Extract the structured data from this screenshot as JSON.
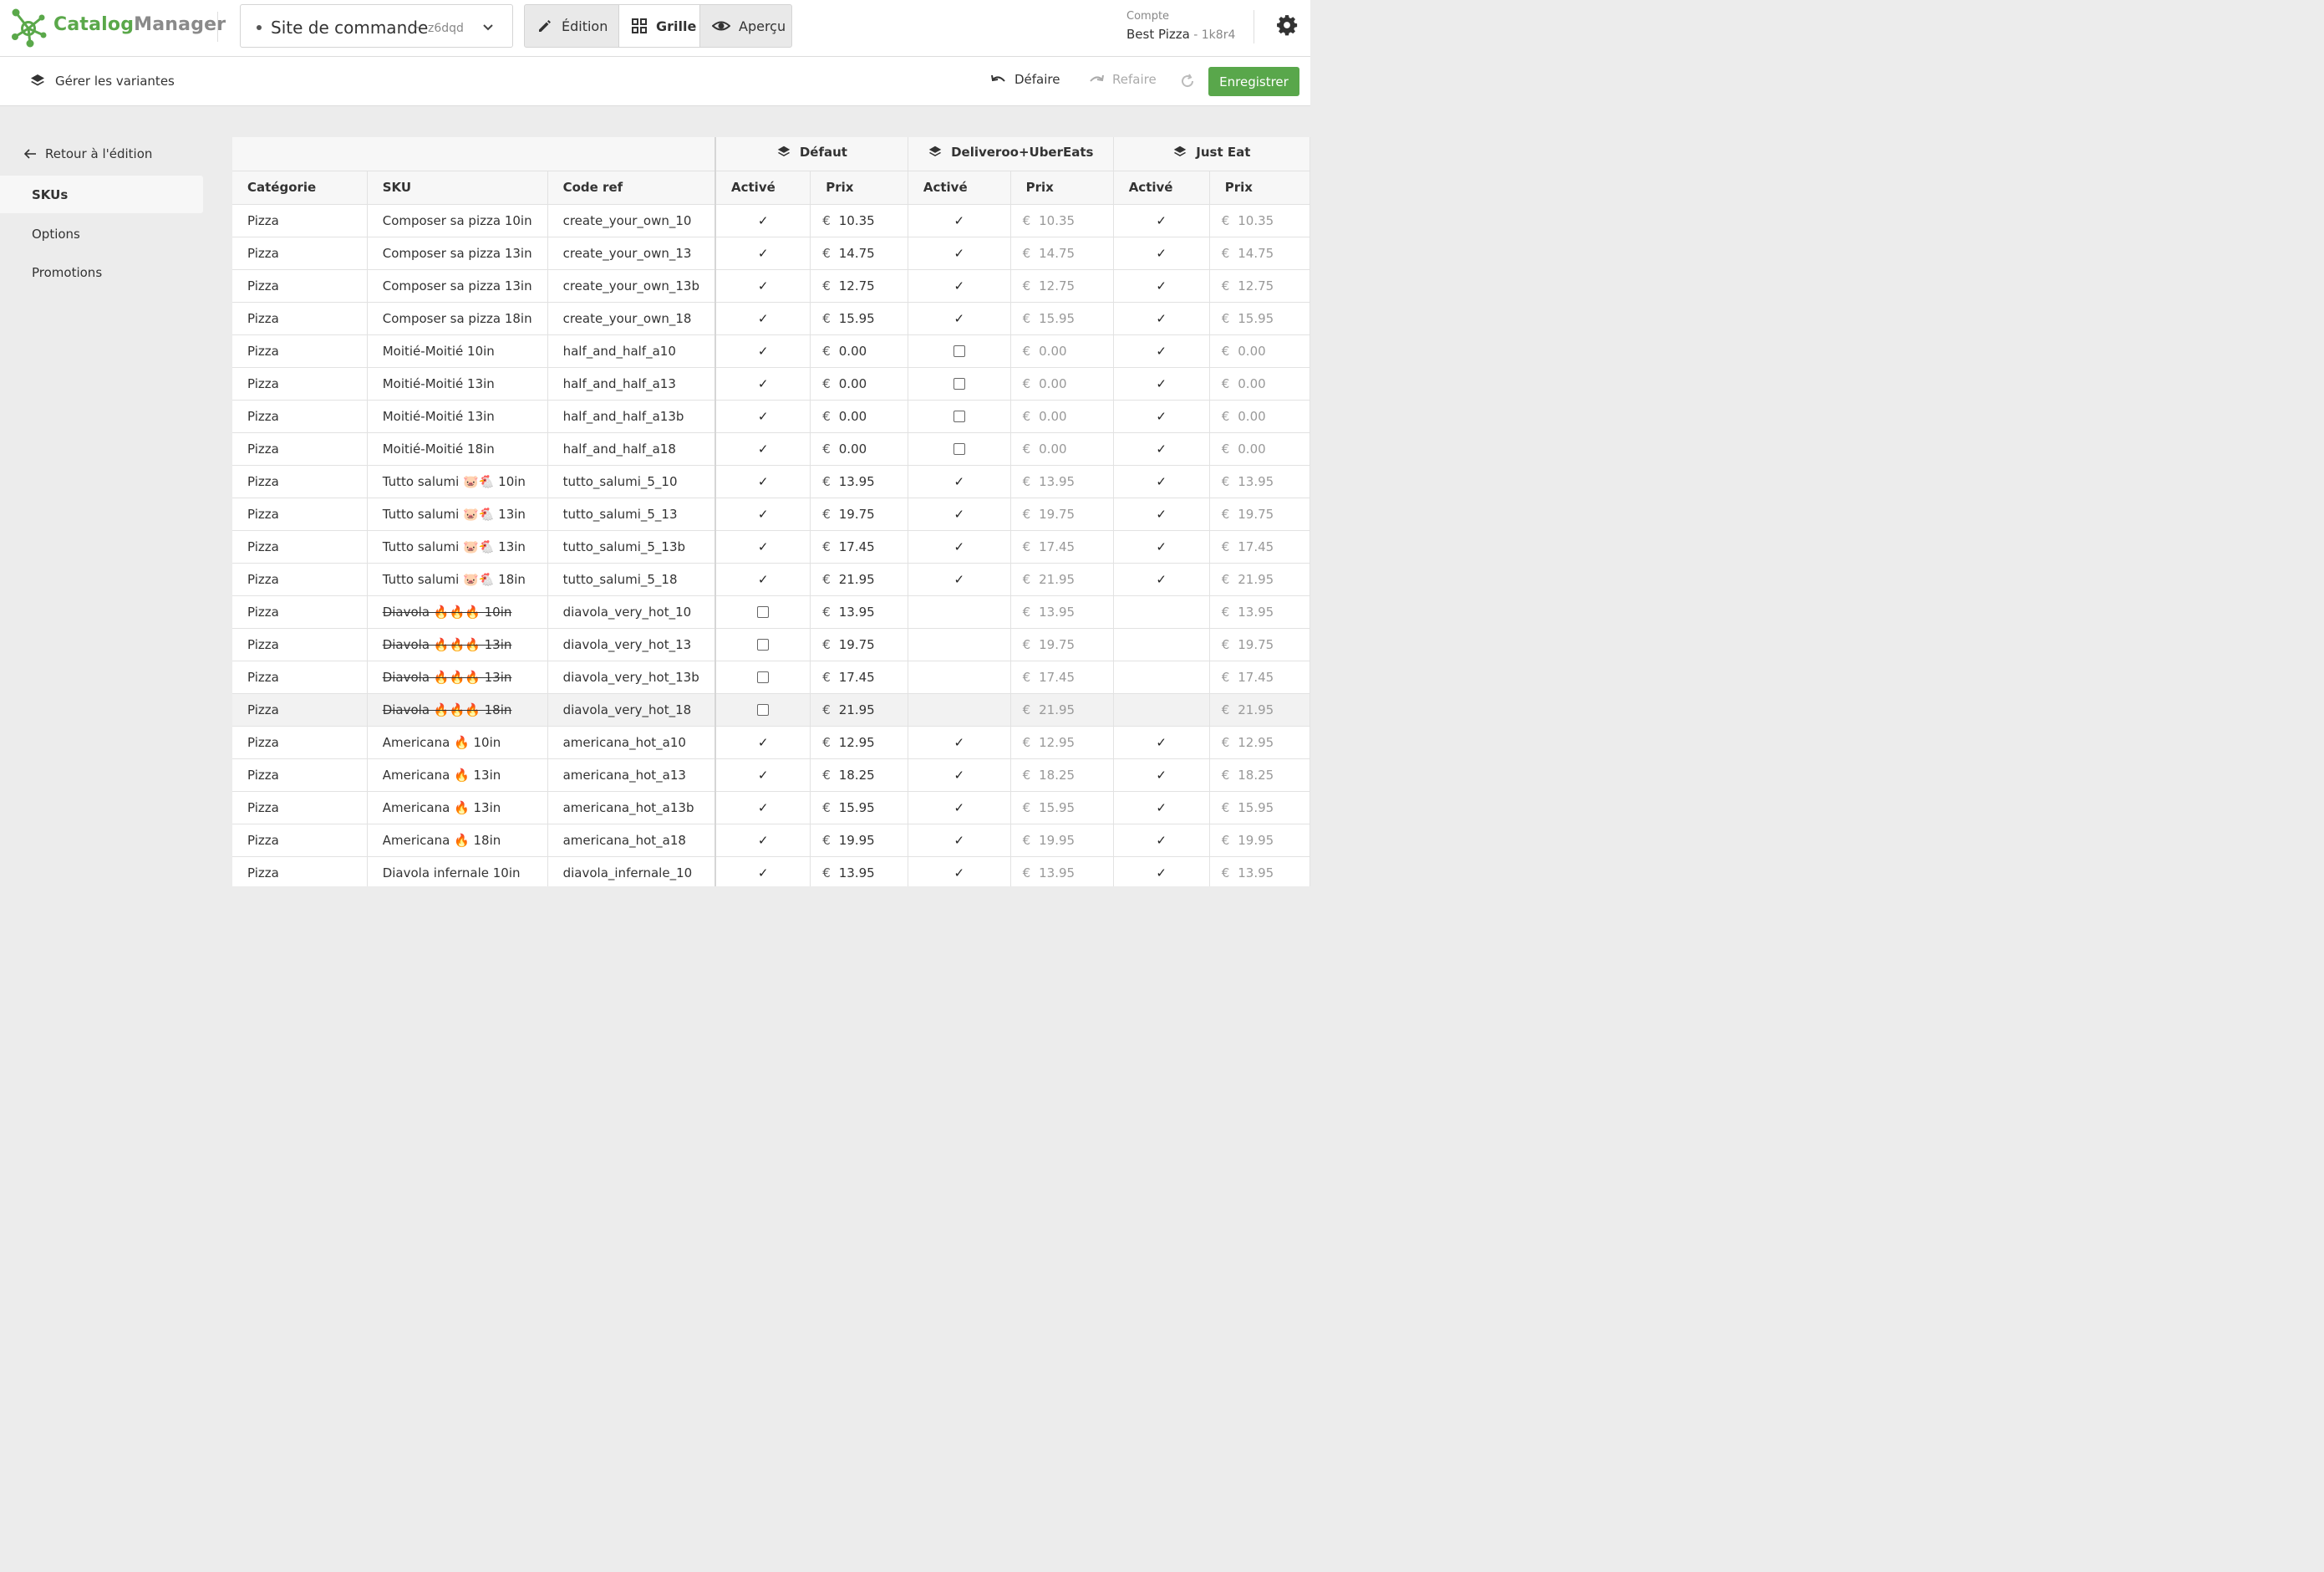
{
  "app": {
    "brand_a": "Catalog",
    "brand_b": "Manager"
  },
  "site": {
    "name": "Site de commande",
    "separator": "-",
    "code": "z6dqd"
  },
  "modes": {
    "edit": "Édition",
    "grid": "Grille",
    "preview": "Aperçu"
  },
  "account": {
    "label": "Compte",
    "name": "Best Pizza",
    "separator": " - ",
    "code": "1k8r4"
  },
  "toolbar": {
    "variants": "Gérer les variantes",
    "undo": "Défaire",
    "redo": "Refaire",
    "save": "Enregistrer"
  },
  "sidebar": {
    "back": "Retour à l'édition",
    "items": [
      {
        "label": "SKUs",
        "active": true
      },
      {
        "label": "Options",
        "active": false
      },
      {
        "label": "Promotions",
        "active": false
      }
    ]
  },
  "table": {
    "variants": [
      "Défaut",
      "Deliveroo+UberEats",
      "Just Eat"
    ],
    "columns": {
      "category": "Catégorie",
      "sku": "SKU",
      "code": "Code ref",
      "active": "Activé",
      "price": "Prix"
    },
    "currency": "€",
    "rows": [
      {
        "category": "Pizza",
        "sku": "Composer sa pizza 10in",
        "code": "create_your_own_10",
        "strike": false,
        "v": [
          [
            "check",
            "10.35"
          ],
          [
            "check",
            "10.35"
          ],
          [
            "check",
            "10.35"
          ]
        ]
      },
      {
        "category": "Pizza",
        "sku": "Composer sa pizza 13in",
        "code": "create_your_own_13",
        "strike": false,
        "v": [
          [
            "check",
            "14.75"
          ],
          [
            "check",
            "14.75"
          ],
          [
            "check",
            "14.75"
          ]
        ]
      },
      {
        "category": "Pizza",
        "sku": "Composer sa pizza 13in",
        "code": "create_your_own_13b",
        "strike": false,
        "v": [
          [
            "check",
            "12.75"
          ],
          [
            "check",
            "12.75"
          ],
          [
            "check",
            "12.75"
          ]
        ]
      },
      {
        "category": "Pizza",
        "sku": "Composer sa pizza 18in",
        "code": "create_your_own_18",
        "strike": false,
        "v": [
          [
            "check",
            "15.95"
          ],
          [
            "check",
            "15.95"
          ],
          [
            "check",
            "15.95"
          ]
        ]
      },
      {
        "category": "Pizza",
        "sku": "Moitié-Moitié 10in",
        "code": "half_and_half_a10",
        "strike": false,
        "v": [
          [
            "check",
            "0.00"
          ],
          [
            "box",
            "0.00"
          ],
          [
            "check",
            "0.00"
          ]
        ]
      },
      {
        "category": "Pizza",
        "sku": "Moitié-Moitié 13in",
        "code": "half_and_half_a13",
        "strike": false,
        "v": [
          [
            "check",
            "0.00"
          ],
          [
            "box",
            "0.00"
          ],
          [
            "check",
            "0.00"
          ]
        ]
      },
      {
        "category": "Pizza",
        "sku": "Moitié-Moitié 13in",
        "code": "half_and_half_a13b",
        "strike": false,
        "v": [
          [
            "check",
            "0.00"
          ],
          [
            "box",
            "0.00"
          ],
          [
            "check",
            "0.00"
          ]
        ]
      },
      {
        "category": "Pizza",
        "sku": "Moitié-Moitié 18in",
        "code": "half_and_half_a18",
        "strike": false,
        "v": [
          [
            "check",
            "0.00"
          ],
          [
            "box",
            "0.00"
          ],
          [
            "check",
            "0.00"
          ]
        ]
      },
      {
        "category": "Pizza",
        "sku": "Tutto salumi 🐷🐔 10in",
        "code": "tutto_salumi_5_10",
        "strike": false,
        "v": [
          [
            "check",
            "13.95"
          ],
          [
            "check",
            "13.95"
          ],
          [
            "check",
            "13.95"
          ]
        ]
      },
      {
        "category": "Pizza",
        "sku": "Tutto salumi 🐷🐔 13in",
        "code": "tutto_salumi_5_13",
        "strike": false,
        "v": [
          [
            "check",
            "19.75"
          ],
          [
            "check",
            "19.75"
          ],
          [
            "check",
            "19.75"
          ]
        ]
      },
      {
        "category": "Pizza",
        "sku": "Tutto salumi 🐷🐔 13in",
        "code": "tutto_salumi_5_13b",
        "strike": false,
        "v": [
          [
            "check",
            "17.45"
          ],
          [
            "check",
            "17.45"
          ],
          [
            "check",
            "17.45"
          ]
        ]
      },
      {
        "category": "Pizza",
        "sku": "Tutto salumi 🐷🐔 18in",
        "code": "tutto_salumi_5_18",
        "strike": false,
        "v": [
          [
            "check",
            "21.95"
          ],
          [
            "check",
            "21.95"
          ],
          [
            "check",
            "21.95"
          ]
        ]
      },
      {
        "category": "Pizza",
        "sku": "Diavola 🔥🔥🔥 10in",
        "code": "diavola_very_hot_10",
        "strike": true,
        "v": [
          [
            "box",
            "13.95"
          ],
          [
            "none",
            "13.95"
          ],
          [
            "none",
            "13.95"
          ]
        ]
      },
      {
        "category": "Pizza",
        "sku": "Diavola 🔥🔥🔥 13in",
        "code": "diavola_very_hot_13",
        "strike": true,
        "v": [
          [
            "box",
            "19.75"
          ],
          [
            "none",
            "19.75"
          ],
          [
            "none",
            "19.75"
          ]
        ]
      },
      {
        "category": "Pizza",
        "sku": "Diavola 🔥🔥🔥 13in",
        "code": "diavola_very_hot_13b",
        "strike": true,
        "v": [
          [
            "box",
            "17.45"
          ],
          [
            "none",
            "17.45"
          ],
          [
            "none",
            "17.45"
          ]
        ]
      },
      {
        "category": "Pizza",
        "sku": "Diavola 🔥🔥🔥 18in",
        "code": "diavola_very_hot_18",
        "strike": true,
        "v": [
          [
            "box",
            "21.95"
          ],
          [
            "none",
            "21.95"
          ],
          [
            "none",
            "21.95"
          ]
        ],
        "highlight": true
      },
      {
        "category": "Pizza",
        "sku": "Americana 🔥 10in",
        "code": "americana_hot_a10",
        "strike": false,
        "v": [
          [
            "check",
            "12.95"
          ],
          [
            "check",
            "12.95"
          ],
          [
            "check",
            "12.95"
          ]
        ]
      },
      {
        "category": "Pizza",
        "sku": "Americana 🔥 13in",
        "code": "americana_hot_a13",
        "strike": false,
        "v": [
          [
            "check",
            "18.25"
          ],
          [
            "check",
            "18.25"
          ],
          [
            "check",
            "18.25"
          ]
        ]
      },
      {
        "category": "Pizza",
        "sku": "Americana 🔥 13in",
        "code": "americana_hot_a13b",
        "strike": false,
        "v": [
          [
            "check",
            "15.95"
          ],
          [
            "check",
            "15.95"
          ],
          [
            "check",
            "15.95"
          ]
        ]
      },
      {
        "category": "Pizza",
        "sku": "Americana 🔥 18in",
        "code": "americana_hot_a18",
        "strike": false,
        "v": [
          [
            "check",
            "19.95"
          ],
          [
            "check",
            "19.95"
          ],
          [
            "check",
            "19.95"
          ]
        ]
      },
      {
        "category": "Pizza",
        "sku": "Diavola infernale 10in",
        "code": "diavola_infernale_10",
        "strike": false,
        "v": [
          [
            "check",
            "13.95"
          ],
          [
            "check",
            "13.95"
          ],
          [
            "check",
            "13.95"
          ]
        ]
      }
    ]
  },
  "colors": {
    "accent": "#59a74b",
    "muted_text": "#999999"
  }
}
